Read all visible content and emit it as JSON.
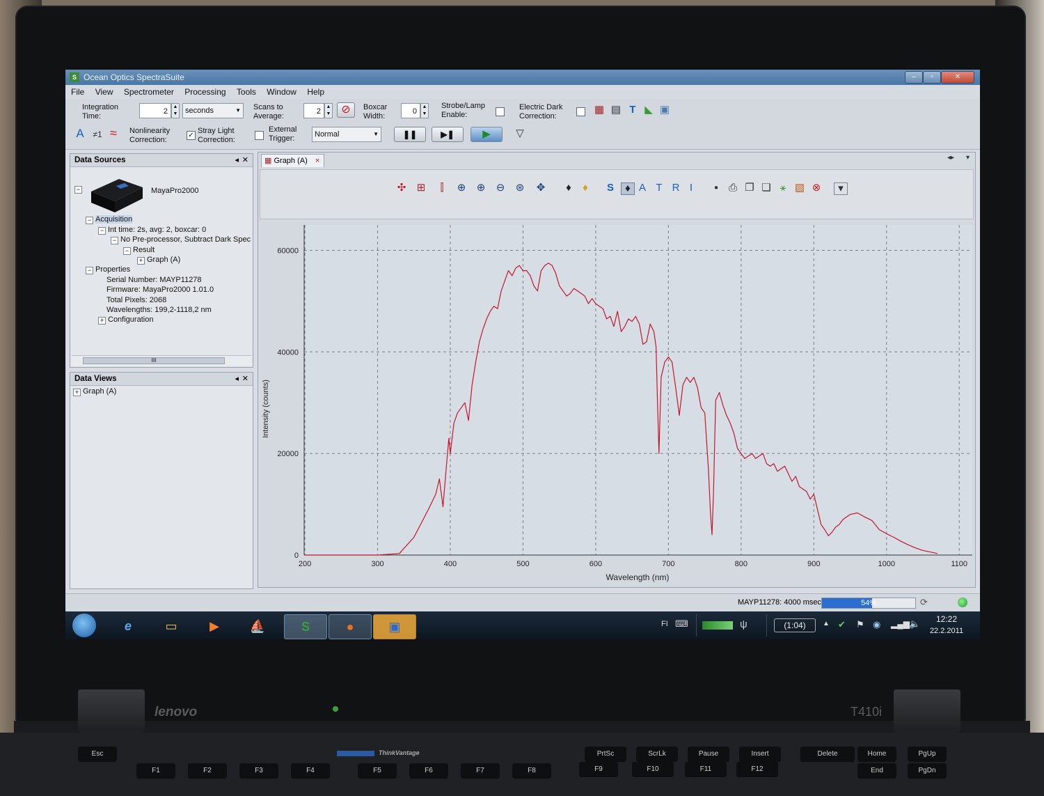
{
  "window": {
    "title": "Ocean Optics SpectraSuite",
    "minimize": "–",
    "maximize": "▫",
    "close": "✕"
  },
  "menu": [
    "File",
    "View",
    "Spectrometer",
    "Processing",
    "Tools",
    "Window",
    "Help"
  ],
  "toolbar": {
    "integration_time_label_1": "Integration",
    "integration_time_label_2": "Time:",
    "integration_time_value": "2",
    "integration_unit": "seconds",
    "scans_label_1": "Scans to",
    "scans_label_2": "Average:",
    "scans_value": "2",
    "boxcar_label_1": "Boxcar",
    "boxcar_label_2": "Width:",
    "boxcar_value": "0",
    "strobe_label_1": "Strobe/Lamp",
    "strobe_label_2": "Enable:",
    "electric_dark_label_1": "Electric Dark",
    "electric_dark_label_2": "Correction:",
    "nonlinearity_label_1": "Nonlinearity",
    "nonlinearity_label_2": "Correction:",
    "stray_light_label_1": "Stray Light",
    "stray_light_label_2": "Correction:",
    "stray_light_checked": "✓",
    "external_trigger_label_1": "External",
    "external_trigger_label_2": "Trigger:",
    "trigger_mode": "Normal",
    "text_a": "A",
    "ne1": "≠1",
    "wave": "≈"
  },
  "data_sources": {
    "header": "Data Sources",
    "device": "MayaPro2000",
    "acquisition": "Acquisition",
    "int_time": "Int time: 2s, avg: 2, boxcar: 0",
    "preprocessor": "No Pre-processor, Subtract Dark Spec",
    "result": "Result",
    "graph": "Graph (A)",
    "properties": "Properties",
    "serial": "Serial Number: MAYP11278",
    "firmware": "Firmware: MayaPro2000 1.01.0",
    "pixels": "Total Pixels: 2068",
    "wavelengths": "Wavelengths: 199,2-1118,2 nm",
    "configuration": "Configuration",
    "scroll_grip": "III"
  },
  "data_views": {
    "header": "Data Views",
    "graph": "Graph (A)"
  },
  "graph_tab": {
    "label": "Graph (A)",
    "close": "×"
  },
  "graph_toolbar_letters": [
    "S",
    "A",
    "T",
    "R",
    "I"
  ],
  "chart_data": {
    "type": "line",
    "title": "",
    "xlabel": "Wavelength (nm)",
    "ylabel": "Intensity (counts)",
    "xlim": [
      199,
      1118
    ],
    "ylim": [
      0,
      65000
    ],
    "x_ticks": [
      200,
      300,
      400,
      500,
      600,
      700,
      800,
      900,
      1000,
      1100
    ],
    "y_ticks": [
      0,
      20000,
      40000,
      60000
    ],
    "x_tick_labels": [
      "200",
      "300",
      "400",
      "500",
      "600",
      "700",
      "800",
      "900",
      "1000",
      "1100"
    ],
    "y_tick_labels": [
      "0",
      "20000",
      "40000",
      "60000"
    ],
    "grid": true,
    "line_color": "#c0182a",
    "x": [
      200,
      300,
      330,
      350,
      370,
      380,
      385,
      390,
      395,
      398,
      400,
      405,
      410,
      420,
      425,
      430,
      435,
      440,
      445,
      450,
      455,
      460,
      465,
      470,
      475,
      480,
      485,
      490,
      495,
      500,
      505,
      510,
      515,
      520,
      525,
      530,
      535,
      540,
      545,
      550,
      555,
      560,
      565,
      570,
      575,
      580,
      585,
      590,
      595,
      600,
      605,
      610,
      615,
      620,
      625,
      630,
      635,
      640,
      645,
      650,
      655,
      660,
      665,
      670,
      675,
      680,
      683,
      685,
      687,
      690,
      695,
      700,
      705,
      710,
      715,
      720,
      725,
      730,
      735,
      740,
      745,
      750,
      755,
      758,
      760,
      762,
      765,
      770,
      775,
      780,
      785,
      790,
      795,
      800,
      805,
      810,
      815,
      820,
      825,
      830,
      835,
      840,
      845,
      850,
      855,
      860,
      865,
      870,
      875,
      880,
      885,
      890,
      895,
      900,
      905,
      910,
      915,
      920,
      925,
      930,
      935,
      940,
      945,
      950,
      960,
      970,
      980,
      990,
      1000,
      1010,
      1020,
      1030,
      1040,
      1050,
      1060,
      1070,
      1080,
      1090,
      1100,
      1110,
      1118
    ],
    "y": [
      0,
      0,
      300,
      3500,
      9000,
      12000,
      15000,
      9500,
      18000,
      23000,
      20000,
      26000,
      28000,
      30000,
      26500,
      33500,
      38000,
      42000,
      44500,
      46500,
      48000,
      49000,
      48500,
      52000,
      54000,
      56000,
      55000,
      56500,
      57000,
      56000,
      56000,
      55000,
      53000,
      52000,
      56000,
      57000,
      57500,
      57000,
      55500,
      53000,
      52000,
      51000,
      51500,
      52500,
      52000,
      51500,
      51000,
      49500,
      50500,
      49500,
      49000,
      48500,
      46500,
      47000,
      45000,
      48000,
      44000,
      45000,
      46500,
      46000,
      47000,
      45500,
      41500,
      42000,
      45500,
      44000,
      41000,
      30000,
      20000,
      35000,
      38000,
      39000,
      38000,
      33000,
      27500,
      33500,
      35000,
      34000,
      35000,
      33000,
      29000,
      28000,
      17000,
      8000,
      4000,
      12000,
      30500,
      32000,
      29500,
      27500,
      26000,
      24000,
      21000,
      20000,
      19000,
      19500,
      20000,
      19000,
      19500,
      20000,
      18000,
      17500,
      18000,
      16500,
      17000,
      17500,
      16000,
      14500,
      15500,
      13500,
      13000,
      12500,
      11000,
      12000,
      9000,
      6000,
      5000,
      3800,
      4500,
      5500,
      6000,
      7000,
      7500,
      8000,
      8300,
      7500,
      6800,
      5000,
      4200,
      3500,
      2700,
      2000,
      1400,
      900,
      600,
      300
    ],
    "annotations": []
  },
  "status": {
    "device_info": "MAYP11278: 4000 msec",
    "progress_pct": 54,
    "progress_text": "54%"
  },
  "taskbar": {
    "lang": "FI",
    "battery": "(1:04)",
    "time": "12:22",
    "date": "22.2.2011"
  },
  "laptop": {
    "brand": "lenovo",
    "model": "T410i",
    "thinkvantage": "ThinkVantage"
  },
  "keys": [
    "Esc",
    "F1",
    "F2",
    "F3",
    "F4",
    "F5",
    "F6",
    "F7",
    "F8",
    "F9",
    "F10",
    "F11",
    "F12",
    "PrtSc",
    "ScrLk",
    "Pause",
    "Insert",
    "Delete",
    "Home",
    "PgUp",
    "End",
    "PgDn"
  ]
}
